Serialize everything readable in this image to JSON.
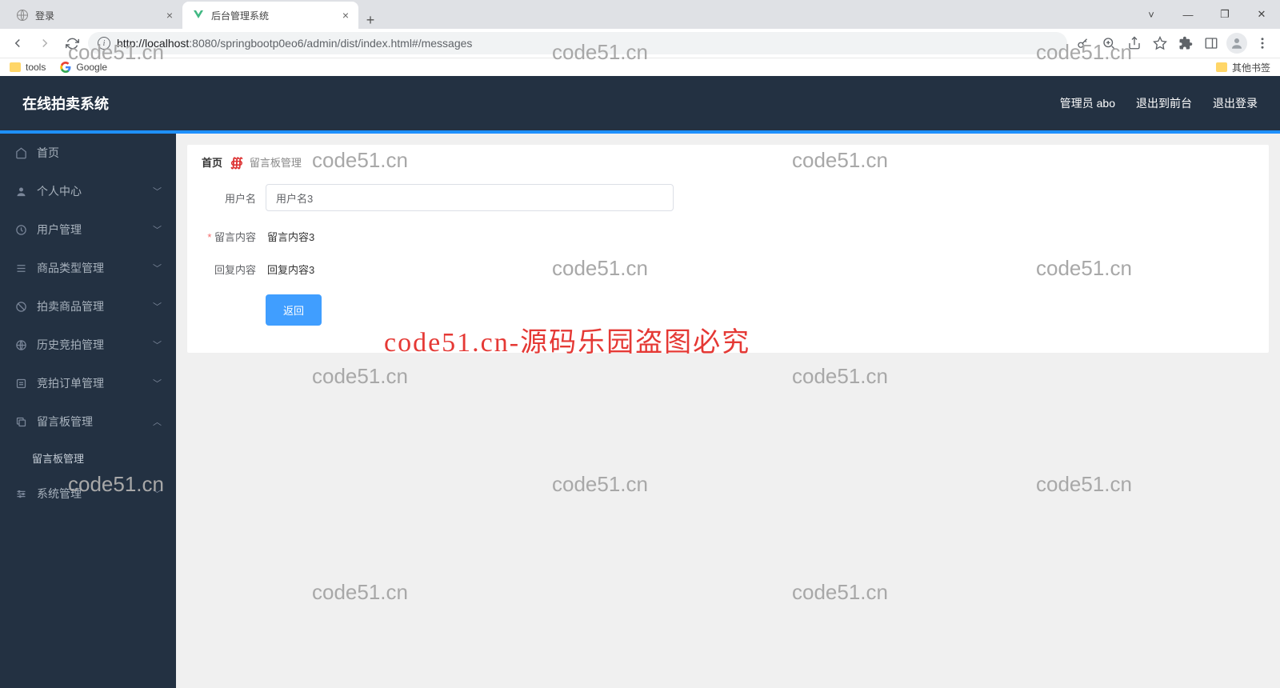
{
  "browser": {
    "tabs": [
      {
        "title": "登录",
        "active": false
      },
      {
        "title": "后台管理系统",
        "active": true
      }
    ],
    "url": "http://localhost:8080/springbootp0eo6/admin/dist/index.html#/messages",
    "url_host": "localhost",
    "url_rest": ":8080/springbootp0eo6/admin/dist/index.html#/messages",
    "bookmarks": {
      "tools": "tools",
      "google": "Google",
      "other": "其他书签"
    }
  },
  "header": {
    "title": "在线拍卖系统",
    "admin": "管理员 abo",
    "to_front": "退出到前台",
    "logout": "退出登录"
  },
  "sidebar": {
    "home": "首页",
    "personal": "个人中心",
    "user_mgmt": "用户管理",
    "product_type": "商品类型管理",
    "auction_product": "拍卖商品管理",
    "history_bid": "历史竞拍管理",
    "bid_order": "竞拍订单管理",
    "message_board": "留言板管理",
    "message_board_sub": "留言板管理",
    "system": "系统管理"
  },
  "breadcrumb": {
    "home": "首页",
    "page": "留言板管理"
  },
  "form": {
    "username_label": "用户名",
    "username_value": "用户名3",
    "content_label": "留言内容",
    "content_value": "留言内容3",
    "reply_label": "回复内容",
    "reply_value": "回复内容3",
    "back_btn": "返回"
  },
  "watermarks": {
    "text": "code51.cn",
    "main": "code51.cn-源码乐园盗图必究"
  }
}
